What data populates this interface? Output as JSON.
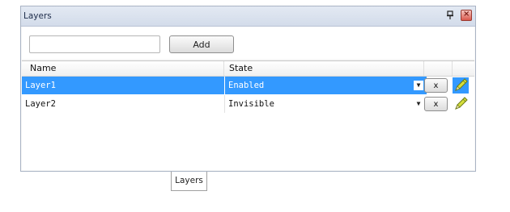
{
  "panel": {
    "title": "Layers",
    "pin_icon": "pin-icon",
    "close_icon": "close-icon",
    "close_glyph": "×"
  },
  "toolbar": {
    "search_value": "",
    "add_label": "Add"
  },
  "grid": {
    "columns": [
      "Name",
      "State"
    ],
    "rows": [
      {
        "name": "Layer1",
        "state": "Enabled",
        "delete_label": "x",
        "selected": true
      },
      {
        "name": "Layer2",
        "state": "Invisible",
        "delete_label": "x",
        "selected": false
      }
    ]
  },
  "bottom_tab": {
    "label": "Layers"
  },
  "colors": {
    "selection": "#3399ff",
    "titlebar": "#d3dcea"
  }
}
